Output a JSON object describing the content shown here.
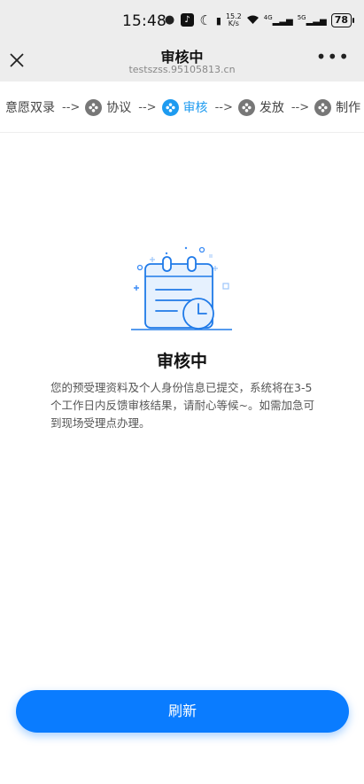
{
  "status_bar": {
    "time": "15:48",
    "net_speed_value": "15.2",
    "net_speed_unit": "K/s",
    "signal_4g": "4G",
    "signal_5g": "5G",
    "battery": "78"
  },
  "nav": {
    "close_icon": "close-icon",
    "title": "审核中",
    "url": "testszss.95105813.cn",
    "more_icon": "more-icon",
    "more_glyph": "•••"
  },
  "steps": {
    "arrow": "-->",
    "items": [
      {
        "label": "意愿双录",
        "active": false
      },
      {
        "label": "协议",
        "active": false
      },
      {
        "label": "审核",
        "active": true
      },
      {
        "label": "发放",
        "active": false
      },
      {
        "label": "制作",
        "active": false
      }
    ]
  },
  "status": {
    "title": "审核中",
    "description": "您的预受理资料及个人身份信息已提交，系统将在3-5个工作日内反馈审核结果，请耐心等候~。如需加急可到现场受理点办理。"
  },
  "refresh_label": "刷新",
  "colors": {
    "accent": "#0a7cff",
    "active_step": "#1e9bf0",
    "inactive_step": "#777777"
  }
}
